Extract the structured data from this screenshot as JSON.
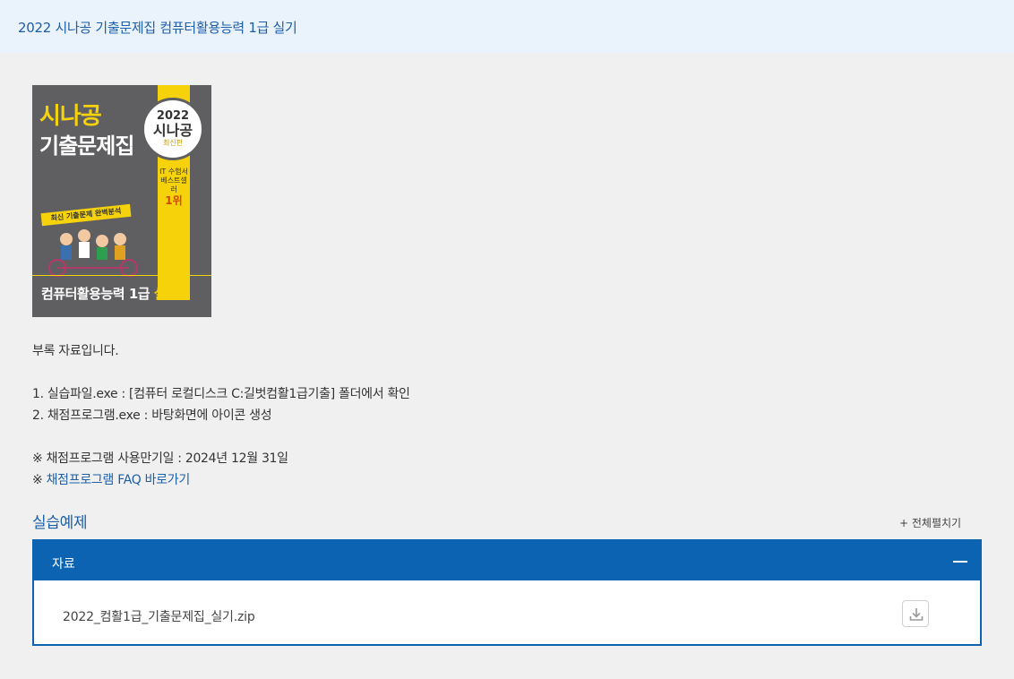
{
  "header": {
    "title": "2022 시나공 기출문제집 컴퓨터활용능력 1급 실기"
  },
  "cover": {
    "brand_line1": "시나공",
    "brand_line2": "기출문제집",
    "seal_year": "2022",
    "seal_brand": "시나공",
    "seal_edition": "최신판",
    "rank_text": "IT 수험서 베스트셀러",
    "rank_value": "1위",
    "ribbon": "최신 기출문제 완벽분석",
    "subject_main": "컴퓨터활용능력 1급",
    "subject_accent": "실기"
  },
  "description": {
    "intro": "부록 자료입니다.",
    "line1": "1. 실습파일.exe :  [컴퓨터 로컬디스크 C:길벗컴활1급기출] 폴더에서 확인",
    "line2": "2. 채점프로그램.exe : 바탕화면에 아이콘 생성",
    "note_prefix": "※ ",
    "note_text": "채점프로그램 사용만기일 :  2024년 12월 31일",
    "faq_link": "채점프로그램 FAQ 바로가기"
  },
  "section": {
    "title": "실습예제",
    "expand_all": "+ 전체펼치기"
  },
  "accordion": {
    "header_label": "자료",
    "file_name": "2022_컴활1급_기출문제집_실기.zip"
  },
  "colors": {
    "accent": "#0b63b2",
    "link": "#1c5ea8",
    "cover_bg": "#5f5f61",
    "cover_yellow": "#f5d20a"
  },
  "icons": {
    "collapse": "minus-icon",
    "download": "download-icon"
  }
}
